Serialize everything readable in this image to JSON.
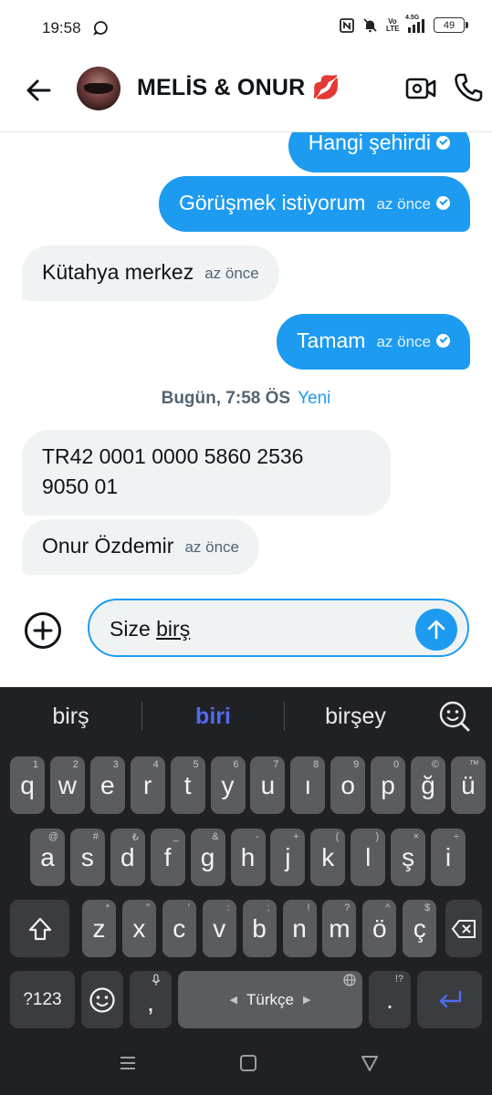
{
  "status_bar": {
    "time": "19:58",
    "volte_line1": "Vo",
    "volte_line2": "LTE",
    "network": "4.5G",
    "battery": "49"
  },
  "header": {
    "title": "MELİS & ONUR 💋"
  },
  "messages": [
    {
      "text": "Hangi şehirdi",
      "time": "",
      "direction": "sent"
    },
    {
      "text": "Görüşmek istiyorum",
      "time": "az önce",
      "direction": "sent"
    },
    {
      "text": "Kütahya merkez",
      "time": "az önce",
      "direction": "received"
    },
    {
      "text": "Tamam",
      "time": "az önce",
      "direction": "sent"
    },
    {
      "line1": "TR42 0001 0000 5860 2536",
      "line2": "9050 01",
      "direction": "received"
    },
    {
      "text": "Onur Özdemir",
      "time": "az önce",
      "direction": "received"
    }
  ],
  "divider": {
    "time": "Bugün, 7:58 ÖS",
    "new_label": "Yeni"
  },
  "composer": {
    "text_plain": "Size ",
    "text_underlined": "birş"
  },
  "keyboard": {
    "suggestions": [
      "birş",
      "biri",
      "birşey"
    ],
    "row1": [
      {
        "k": "q",
        "h": "1"
      },
      {
        "k": "w",
        "h": "2"
      },
      {
        "k": "e",
        "h": "3"
      },
      {
        "k": "r",
        "h": "4"
      },
      {
        "k": "t",
        "h": "5"
      },
      {
        "k": "y",
        "h": "6"
      },
      {
        "k": "u",
        "h": "7"
      },
      {
        "k": "ı",
        "h": "8"
      },
      {
        "k": "o",
        "h": "9"
      },
      {
        "k": "p",
        "h": "0"
      },
      {
        "k": "ğ",
        "h": "©"
      },
      {
        "k": "ü",
        "h": "™"
      }
    ],
    "row2": [
      {
        "k": "a",
        "h": "@"
      },
      {
        "k": "s",
        "h": "#"
      },
      {
        "k": "d",
        "h": "₺"
      },
      {
        "k": "f",
        "h": "_"
      },
      {
        "k": "g",
        "h": "&"
      },
      {
        "k": "h",
        "h": "-"
      },
      {
        "k": "j",
        "h": "+"
      },
      {
        "k": "k",
        "h": "("
      },
      {
        "k": "l",
        "h": ")"
      },
      {
        "k": "ş",
        "h": "×"
      },
      {
        "k": "i",
        "h": "÷"
      }
    ],
    "row3": [
      {
        "k": "z",
        "h": "*"
      },
      {
        "k": "x",
        "h": "\""
      },
      {
        "k": "c",
        "h": "'"
      },
      {
        "k": "v",
        "h": ":"
      },
      {
        "k": "b",
        "h": ";"
      },
      {
        "k": "n",
        "h": "!"
      },
      {
        "k": "m",
        "h": "?"
      },
      {
        "k": "ö",
        "h": "^"
      },
      {
        "k": "ç",
        "h": "$"
      }
    ],
    "symbols_label": "?123",
    "comma": ",",
    "space_label": "Türkçe",
    "period": ".",
    "period_hint": "!?"
  }
}
